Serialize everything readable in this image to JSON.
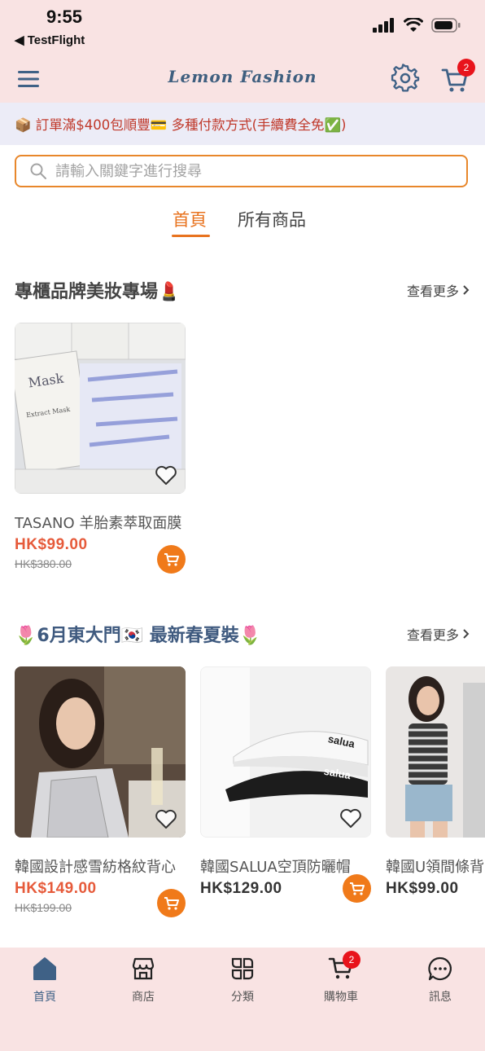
{
  "status_bar": {
    "time": "9:55",
    "back_app": "◀ TestFlight"
  },
  "header": {
    "logo": "Lemon Fashion",
    "cart_count": "2"
  },
  "promo": {
    "text": "📦 訂單滿$400包順豐💳 多種付款方式(手續費全免✅)"
  },
  "search": {
    "placeholder": "請輸入關鍵字進行搜尋"
  },
  "tabs": [
    {
      "label": "首頁",
      "active": true
    },
    {
      "label": "所有商品",
      "active": false
    }
  ],
  "section1": {
    "title": "專櫃品牌美妝專場💄",
    "see_more": "查看更多",
    "products": [
      {
        "name": "TASANO 羊胎素萃取面膜",
        "price": "HK$99.00",
        "old_price": "HK$380.00"
      }
    ]
  },
  "section2": {
    "title": "🌷6月東大門🇰🇷 最新春夏裝🌷",
    "see_more": "查看更多",
    "products": [
      {
        "name": "韓國設計感雪紡格紋背心",
        "price": "HK$149.00",
        "old_price": "HK$199.00"
      },
      {
        "name": "韓國SALUA空頂防曬帽",
        "price": "HK$129.00"
      },
      {
        "name": "韓國U領間條背心",
        "price": "HK$99.00"
      }
    ]
  },
  "bottom_nav": [
    {
      "label": "首頁",
      "icon": "home-icon",
      "active": true
    },
    {
      "label": "商店",
      "icon": "store-icon"
    },
    {
      "label": "分類",
      "icon": "category-icon"
    },
    {
      "label": "購物車",
      "icon": "cart-icon",
      "badge": "2"
    },
    {
      "label": "訊息",
      "icon": "chat-icon"
    }
  ],
  "colors": {
    "accent": "#e8731f",
    "header_bg": "#f9e3e3",
    "price": "#e65a3a",
    "primary": "#3f6186"
  }
}
